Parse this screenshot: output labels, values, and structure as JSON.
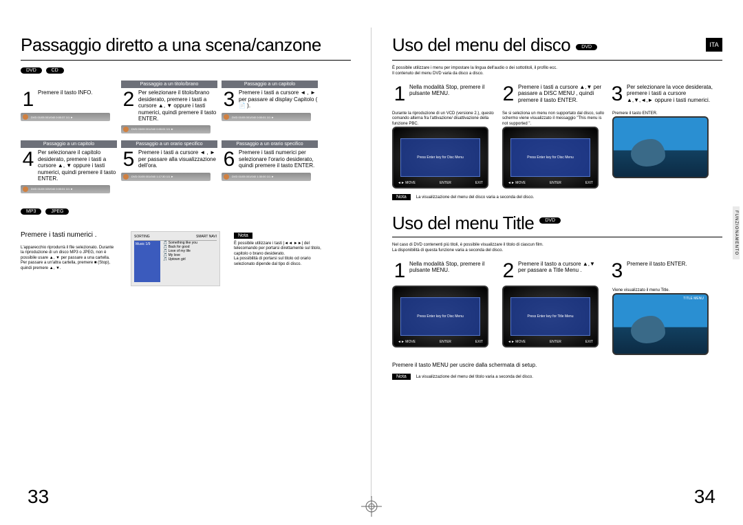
{
  "leftPage": {
    "title": "Passaggio diretto a una scena/canzone",
    "badges": {
      "dvd": "DVD",
      "cd": "CD"
    },
    "row1": {
      "s1": {
        "num": "1",
        "text": "Premere il tasto INFO."
      },
      "s2": {
        "header": "Passaggio a un titolo/brano",
        "num": "2",
        "text": "Per selezionare il titolo/brano desiderato, premere i tasti a cursore ▲, ▼ oppure i tasti numerici, quindi premere il tasto ENTER."
      },
      "s3": {
        "header": "Passaggio a un capitolo",
        "num": "3",
        "text": "Premere i tasti a cursore ◄ , ► per passare al display Capitolo (   📄   )."
      }
    },
    "row2": {
      "s4": {
        "header": "Passaggio a un capitolo",
        "num": "4",
        "text": "Per selezionare il capitolo desiderato, premere i tasti a cursore ▲, ▼ oppure i tasti numerici, quindi premere il tasto ENTER."
      },
      "s5": {
        "header": "Passaggio a un orario specifico",
        "num": "5",
        "text": "Premere i tasti a cursore ◄ , ► per passare alla visualizzazione dell'ora."
      },
      "s6": {
        "header": "Passaggio a un orario specifico",
        "num": "6",
        "text": "Premere i tasti numerici per selezionare l'orario desiderato, quindi premere il tasto ENTER."
      }
    },
    "osd": {
      "a": "DVD 01/05 001/040 0:00:37 1/1 ►",
      "b": "DVD 03/05 001/040 0:00:01 1/1 ►",
      "c": "DVD 01/05 001/040 0:00:01 1/1 ►",
      "d": "DVD 01/05 020/040 0:00:01 1/1 ►",
      "e": "DVD 01/05 001/040 1:17:30 1/1 ►",
      "f": "DVD 01/05 001/040 1:30:00 1/1 ►"
    },
    "badges2": {
      "mp3": "MP3",
      "jpeg": "JPEG"
    },
    "mp3block": {
      "title": "Premere i tasti numerici .",
      "body": "L'apparecchio riprodurrà il file selezionato. Durante la riproduzione di un disco MP3 o JPEG, non è possibile usare ▲, ▼ per passare a una cartella. Per passare a un'altra cartella, premere ■ (Stop), quindi premere ▲, ▼."
    },
    "mp3screen": {
      "sorting": "SORTING",
      "smartnavi": "SMART NAVI",
      "item1": "Something like you",
      "item2": "Back for good",
      "item3": "Love of my life",
      "item4": "My love",
      "item5": "Uptown girl",
      "musicdir": "Music  1/9"
    },
    "notaLabel": "Nota",
    "notaText": "È possibile utilizzare i tasti |◄◄ ►►| del telecomando per portarsi direttamente sul titolo, capitolo o brano desiderato.\nLa possibilità di portarsi sul titolo od orario selezionato dipende dal tipo di disco.",
    "pageNum": "33"
  },
  "rightPage": {
    "title1": "Uso del menu del disco",
    "dvdBadge": "DVD",
    "itaBadge": "ITA",
    "intro": "È possibile utilizzare i menu per impostare la lingua dell'audio o dei sottotitoli, il profilo ecc.\nIl contenuto del menu DVD varia da disco a disco.",
    "rowA": {
      "s1": {
        "num": "1",
        "text": "Nella modalità Stop, premere il pulsante MENU."
      },
      "s2": {
        "num": "2",
        "text": "Premere i tasti a cursore ▲,▼ per passare a  DISC MENU , quindi premere il tasto ENTER."
      },
      "s3": {
        "num": "3",
        "text": "Per selezionare la voce desiderata, premere i tasti a cursore ▲,▼,◄,► oppure i tasti numerici."
      }
    },
    "figcaps": {
      "a": "Durante la riproduzione di un VCD (versione 2.), questo comando alterna fra l'attivazione/ disattivazione della funzione PBC.",
      "b": "Se si seleziona un menu non supportato dal disco, sullo schermo viene visualizzato il messaggio \"This menu is not supported \".",
      "c": "Premere il tasto ENTER."
    },
    "crtLabels": {
      "disc": "DISC MENU",
      "enter": "Press Enter key for Disc Menu",
      "move": "◄► MOVE",
      "enterbtn": "ENTER",
      "exit": "EXIT"
    },
    "note1Label": "Nota",
    "note1Text": "La visualizzazione del menu del disco varia a seconda del disco.",
    "title2": "Uso del menu Title",
    "intro2": "Nel caso di DVD contenenti più titoli, è possibile visualizzare il titolo di ciascun film.\nLa disponibilità di questa funzione varia a seconda del disco.",
    "rowB": {
      "s1": {
        "num": "1",
        "text": "Nella modalità Stop, premere il pulsante MENU."
      },
      "s2": {
        "num": "2",
        "text": "Premere il tasto a cursore ▲,▼ per passare a Title Menu ."
      },
      "s3": {
        "num": "3",
        "text": "Premere il tasto ENTER."
      }
    },
    "figcapB": "Viene visualizzato il menu Title.",
    "crtLabelsB": {
      "title": "TITLE MENU",
      "enter": "Press Enter key for Title Menu"
    },
    "closing": "Premere il tasto MENU per uscire dalla schermata di setup.",
    "note2Label": "Nota",
    "note2Text": "La visualizzazione del menu del titolo varia a seconda del disco.",
    "sideTab": "FUNZIONAMENTO",
    "pageNum": "34"
  }
}
